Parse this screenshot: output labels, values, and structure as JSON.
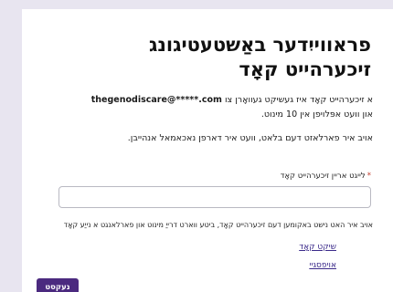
{
  "page": {
    "title": "פראווייִדער באַשטעטיגונג זיכערהייט קאָד",
    "email_masked": "thegenodiscare@*****.com",
    "instructions_before_email": "א זיכערהייט קאָד איז געשיקט געוואָרן צו",
    "instructions_after_email": "און וועט אפּלויפן אין 10 מינוט.",
    "browser_note": "אויב איר פארלאזט דעם בלאט, וועט איר דארפן נאכאמאל אנהייבן.",
    "code_field_label": "לייגט אריין זיכערהייט קאָד",
    "code_value": "",
    "hint": "אויב איר האט נישט באקומען דעם זיכערהייט קאָד, ביטע ווארט דרייַ מינוט און פארלאנגט א נייַע קאָד",
    "resend_label": "שיקט קאָד",
    "cancel_label": "אויפסגיי",
    "next_label": "נעקסט"
  },
  "colors": {
    "page_bg": "#e8e5f0",
    "card_bg": "#ffffff",
    "primary": "#4b2a7f",
    "link": "#3b2a8a",
    "required": "#c0392b"
  }
}
